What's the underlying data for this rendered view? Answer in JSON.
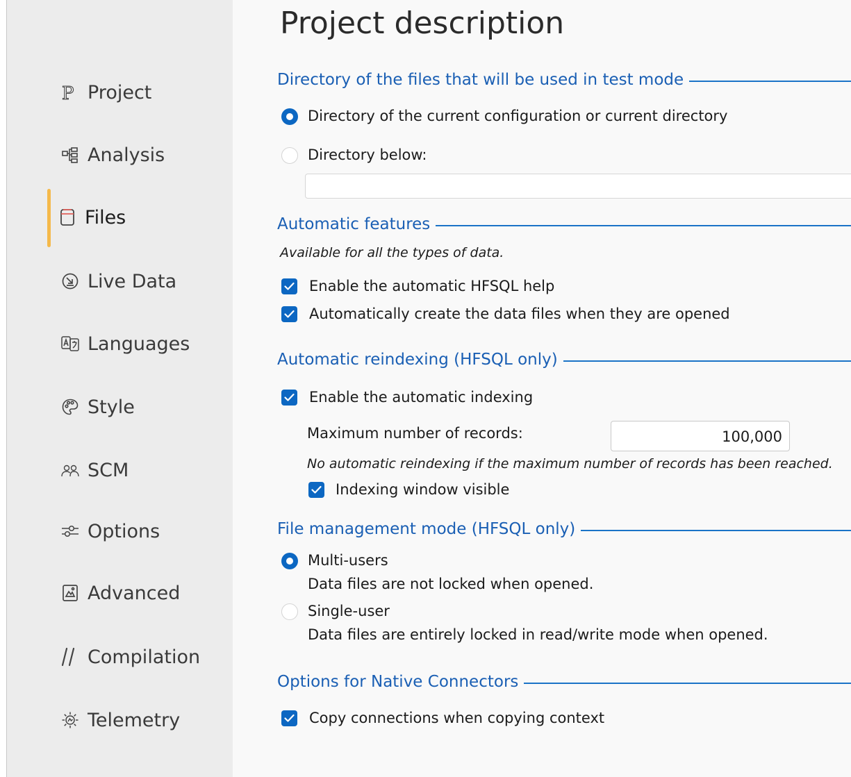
{
  "sidebar": {
    "items": [
      {
        "label": "Project",
        "icon": "project-p-icon"
      },
      {
        "label": "Analysis",
        "icon": "analysis-icon"
      },
      {
        "label": "Files",
        "icon": "files-icon",
        "active": true
      },
      {
        "label": "Live Data",
        "icon": "live-data-icon"
      },
      {
        "label": "Languages",
        "icon": "languages-icon"
      },
      {
        "label": "Style",
        "icon": "palette-icon"
      },
      {
        "label": "SCM",
        "icon": "scm-users-icon"
      },
      {
        "label": "Options",
        "icon": "options-sliders-icon"
      },
      {
        "label": "Advanced",
        "icon": "advanced-icon"
      },
      {
        "label": "Compilation",
        "icon": "compilation-slashes-icon"
      },
      {
        "label": "Telemetry",
        "icon": "telemetry-icon"
      }
    ],
    "active_color": "#f5b94a"
  },
  "main": {
    "title": "Project description",
    "directory": {
      "heading": "Directory of the files that will be used in test mode",
      "option_current": "Directory of the current configuration or current directory",
      "option_below": "Directory below:",
      "selected": "current",
      "path_value": ""
    },
    "automatic_features": {
      "heading": "Automatic features",
      "note": "Available for all the types of data.",
      "enable_help": "Enable the automatic HFSQL help",
      "auto_create": "Automatically create the data files when they are opened"
    },
    "reindexing": {
      "heading": "Automatic reindexing (HFSQL only)",
      "enable_indexing": "Enable the automatic indexing",
      "max_records_label": "Maximum number of records:",
      "max_records_value": "100,000",
      "note": "No automatic reindexing if the maximum number of records has been reached.",
      "window_visible": "Indexing window visible"
    },
    "file_mode": {
      "heading": "File management mode (HFSQL only)",
      "multi_label": "Multi-users",
      "multi_desc": "Data files are not locked when opened.",
      "single_label": "Single-user",
      "single_desc": "Data files are entirely locked in read/write mode when opened.",
      "selected": "multi"
    },
    "native": {
      "heading": "Options for Native Connectors",
      "copy_connections": "Copy connections when copying context"
    }
  },
  "colors": {
    "accent": "#0c67c2",
    "heading": "#1a5fb4",
    "sidebar_bg": "#ececec",
    "main_bg": "#f9f9f9"
  }
}
